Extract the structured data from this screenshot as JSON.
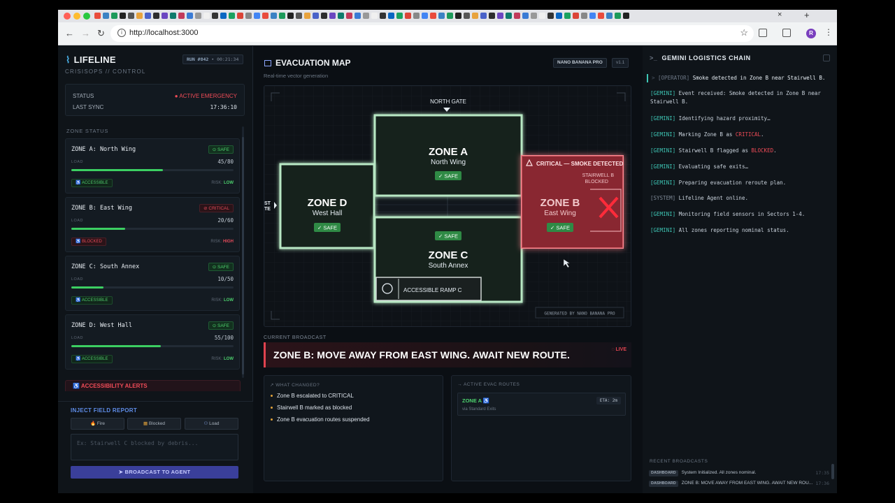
{
  "browser": {
    "url": "http://localhost:3000",
    "tab_close": "×",
    "new_tab": "+"
  },
  "sidebar": {
    "brand": "LIFELINE",
    "brand_sub": "CRISISOPS // CONTROL",
    "run_id": "RUN #842",
    "run_time": "00:21:34",
    "status_label": "STATUS",
    "status_value": "ACTIVE EMERGENCY",
    "sync_label": "LAST SYNC",
    "sync_value": "17:36:10",
    "zone_status_heading": "ZONE STATUS",
    "zones": [
      {
        "name": "ZONE A: North Wing",
        "badge": "SAFE",
        "load_label": "LOAD",
        "count": "45/80",
        "load_fraction": 0.5625,
        "access": "ACCESSIBLE",
        "risk_label": "RISK:",
        "risk": "LOW"
      },
      {
        "name": "ZONE B: East Wing",
        "badge": "CRITICAL",
        "load_label": "LOAD",
        "count": "20/60",
        "load_fraction": 0.3333,
        "access": "BLOCKED",
        "risk_label": "RISK:",
        "risk": "HIGH"
      },
      {
        "name": "ZONE C: South Annex",
        "badge": "SAFE",
        "load_label": "LOAD",
        "count": "10/50",
        "load_fraction": 0.2,
        "access": "ACCESSIBLE",
        "risk_label": "RISK:",
        "risk": "LOW"
      },
      {
        "name": "ZONE D: West Hall",
        "badge": "SAFE",
        "load_label": "LOAD",
        "count": "55/100",
        "load_fraction": 0.55,
        "access": "ACCESSIBLE",
        "risk_label": "RISK:",
        "risk": "LOW"
      }
    ],
    "accessibility_alerts": "ACCESSIBILITY ALERTS",
    "inject_heading": "INJECT FIELD REPORT",
    "inject_buttons": [
      "Fire",
      "Blocked",
      "Load"
    ],
    "report_placeholder": "Ex: Stairwell C blocked by debris...",
    "broadcast_button": "BROADCAST TO AGENT"
  },
  "center": {
    "title": "EVACUATION MAP",
    "subtitle": "Real-time vector generation",
    "engine_badge": "NANO BANANA PRO",
    "version_badge": "v1.1",
    "map": {
      "north_gate": "NORTH GATE",
      "west_label": "ST\nTE",
      "zone_a_title": "ZONE A",
      "zone_a_sub": "North Wing",
      "zone_a_badge": "✓ SAFE",
      "zone_b_title": "ZONE B",
      "zone_b_sub": "East Wing",
      "zone_b_badge": "✓ SAFE",
      "zone_c_title": "ZONE C",
      "zone_c_sub": "South Annex",
      "zone_c_badge": "✓ SAFE",
      "zone_d_title": "ZONE D",
      "zone_d_sub": "West Hall",
      "zone_d_badge": "✓ SAFE",
      "critical_label": "CRITICAL — SMOKE DETECTED",
      "stairwell_line1": "STAIRWELL B",
      "stairwell_line2": "BLOCKED",
      "ramp_label": "ACCESSIBLE RAMP C",
      "generated_by": "GENERATED BY NANO BANANA PRO"
    },
    "broadcast_heading": "CURRENT BROADCAST",
    "broadcast_text": "ZONE B: MOVE AWAY FROM EAST WING. AWAIT NEW ROUTE.",
    "live_label": "LIVE",
    "changes_heading": "WHAT CHANGED?",
    "changes": [
      "Zone B escalated to CRITICAL",
      "Stairwell B marked as blocked",
      "Zone B evacuation routes suspended"
    ],
    "routes_heading": "ACTIVE EVAC ROUTES",
    "route_name": "ZONE A",
    "route_via": "via Standard Exits",
    "route_eta": "ETA: 2m"
  },
  "right": {
    "title": "GEMINI LOGISTICS CHAIN",
    "log": [
      {
        "tag": "[OPERATOR]",
        "text": "Smoke detected in Zone B near Stairwell B.",
        "kind": "op"
      },
      {
        "tag": "[GEMINI]",
        "text": "Event received: Smoke detected in Zone B near Stairwell B.",
        "kind": "g"
      },
      {
        "tag": "[GEMINI]",
        "text": "Identifying hazard proximity…",
        "kind": "g"
      },
      {
        "tag": "[GEMINI]",
        "text": "Marking Zone B as ",
        "hl": "CRITICAL",
        "tail": ".",
        "kind": "g"
      },
      {
        "tag": "[GEMINI]",
        "text": "Stairwell B flagged as ",
        "hl": "BLOCKED",
        "tail": ".",
        "kind": "g"
      },
      {
        "tag": "[GEMINI]",
        "text": "Evaluating safe exits…",
        "kind": "g"
      },
      {
        "tag": "[GEMINI]",
        "text": "Preparing evacuation reroute plan.",
        "kind": "g"
      },
      {
        "tag": "[SYSTEM]",
        "text": "Lifeline Agent online.",
        "kind": "sys"
      },
      {
        "tag": "[GEMINI]",
        "text": "Monitoring field sensors in Sectors 1-4.",
        "kind": "g"
      },
      {
        "tag": "[GEMINI]",
        "text": "All zones reporting nominal status.",
        "kind": "g"
      }
    ],
    "recent_heading": "RECENT BROADCASTS",
    "recent": [
      {
        "source": "DASHBOARD",
        "text": "System Initialized. All zones nominal.",
        "time": "17:35"
      },
      {
        "source": "DASHBOARD",
        "text": "ZONE B: MOVE AWAY FROM EAST WING. AWAIT NEW ROU...",
        "time": "17:36"
      }
    ]
  },
  "colors": {
    "safe": "#3ccf62",
    "critical": "#e0434f",
    "accent": "#5f8de9",
    "teal": "#3ec7b6"
  }
}
